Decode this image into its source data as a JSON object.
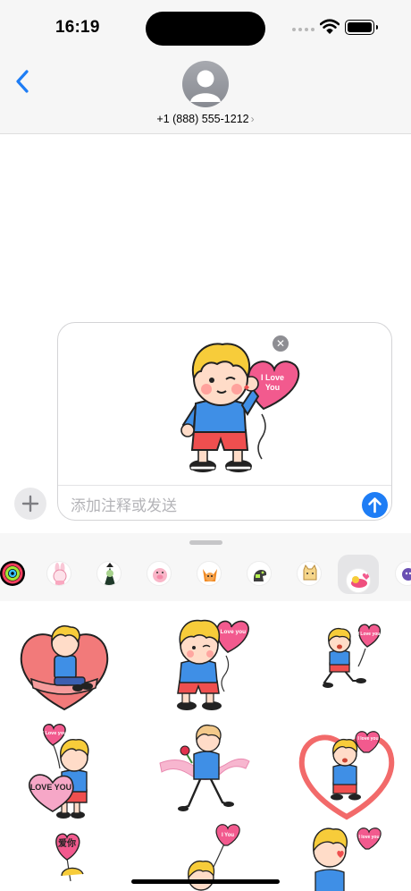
{
  "status_bar": {
    "time": "16:19"
  },
  "header": {
    "contact_name": "+1 (888) 555-1212",
    "chevron": "›"
  },
  "compose": {
    "sticker_text": "I Love you",
    "remove_symbol": "✕",
    "placeholder": "添加注释或发送"
  },
  "drawer": {
    "apps": [
      {
        "name": "activity-app"
      },
      {
        "name": "bunny-sticker-pack"
      },
      {
        "name": "witch-sticker-pack"
      },
      {
        "name": "pig-sticker-pack"
      },
      {
        "name": "fox-sticker-pack"
      },
      {
        "name": "dino-sticker-pack"
      },
      {
        "name": "cat-sticker-pack"
      },
      {
        "name": "love-boy-sticker-pack",
        "selected": true
      },
      {
        "name": "purple-sticker-pack"
      }
    ],
    "stickers": [
      {
        "name": "boy-on-heart-sticker"
      },
      {
        "name": "boy-with-balloon-sticker",
        "text": "I Love you"
      },
      {
        "name": "running-boy-balloon-sticker",
        "text": "I Love you"
      },
      {
        "name": "boy-love-you-heart-sticker",
        "text": "I Love you",
        "text2": "LOVE YOU"
      },
      {
        "name": "boy-with-rose-sticker"
      },
      {
        "name": "boy-in-heart-frame-sticker",
        "text": "I love you"
      },
      {
        "name": "boy-aini-balloon-sticker",
        "text": "爱你"
      },
      {
        "name": "boy-small-balloon-sticker",
        "text": "I You"
      },
      {
        "name": "boy-kiss-sticker",
        "text": "I love you"
      }
    ]
  },
  "colors": {
    "accent": "#1e7df5",
    "pink": "#f25a8e",
    "shirt_blue": "#3f8fe6",
    "shorts_red": "#ef4f4f",
    "hair_yellow": "#f7cc3a"
  }
}
